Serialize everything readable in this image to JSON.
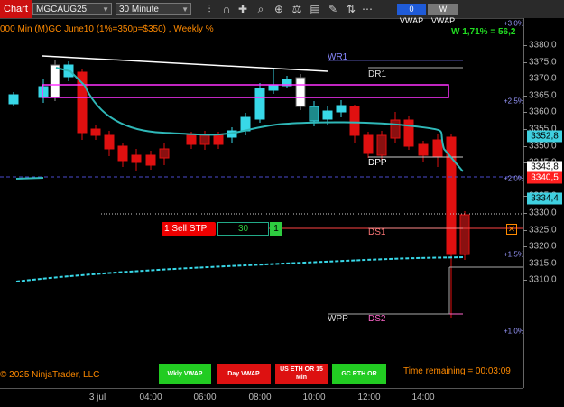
{
  "toolbar": {
    "chart_tab": "Chart",
    "instrument": "MGCAUG25",
    "interval": "30 Minute",
    "vwap_toggle_1": "0 VWAP",
    "vwap_toggle_2": "W VWAP",
    "icons": [
      "bar-type-icon",
      "magnet-icon",
      "crosshair-icon",
      "zoom-icon",
      "properties-icon",
      "strategies-icon",
      "indicators-icon",
      "drawing-tools-icon",
      "chart-trader-icon",
      "more-icon"
    ],
    "colors": {
      "chart_tab": "#cc1010",
      "vwap_toggle_1": "#1f5bd8",
      "vwap_toggle_2": "#777777"
    }
  },
  "chart": {
    "header": "000 Min (M)GC June10 (1%=350p=$350) , Weekly %",
    "weekly_stat": "W 1,71% = 56,2",
    "copyright": "© 2025 NinjaTrader, LLC",
    "time_remaining": "Time remaining = 00:03:09",
    "pivots": {
      "wr1": "WR1",
      "dr1": "DR1",
      "dpp": "DPP",
      "ds1": "DS1",
      "wpp": "WPP",
      "ds2": "DS2"
    },
    "pct_labels": [
      "+3,0%",
      "+2,5%",
      "+2,0%",
      "+1,5%",
      "+1,0%"
    ],
    "time_labels": [
      "3 jul",
      "04:00",
      "06:00",
      "08:00",
      "10:00",
      "12:00",
      "14:00"
    ],
    "price_ticks": [
      "3380,0",
      "3375,0",
      "3370,0",
      "3365,0",
      "3360,0",
      "3355,0",
      "3350,0",
      "3345,0",
      "3340,0",
      "3335,0",
      "3330,0",
      "3325,0",
      "3320,0",
      "3315,0",
      "3310,0"
    ],
    "price_flags": {
      "vwap": "3352,8",
      "last": "3343,8",
      "sell_stop": "3340,5",
      "wvwap": "3334,4"
    },
    "flag_colors": {
      "vwap": "#3fd0e0",
      "last": "#ffffff",
      "sell_stop": "#ff2020",
      "wvwap": "#3fd0e0"
    },
    "candle_colors": {
      "up": "#38d8e8",
      "down": "#e01010",
      "highlight_up": "#ffffff",
      "hollow_up": "#1d8a8a",
      "hollow_down": "#8a1010"
    }
  },
  "order": {
    "label": "1  Sell STP",
    "quantity_field": "30",
    "count": "1"
  },
  "bottom_buttons": [
    {
      "label": "Wkly VWAP",
      "color": "#22cc22"
    },
    {
      "label": "Day VWAP",
      "color": "#dd1111"
    },
    {
      "label": "US ETH OR 15 Min",
      "color": "#dd1111"
    },
    {
      "label": "GC RTH OR",
      "color": "#22cc22"
    }
  ]
}
